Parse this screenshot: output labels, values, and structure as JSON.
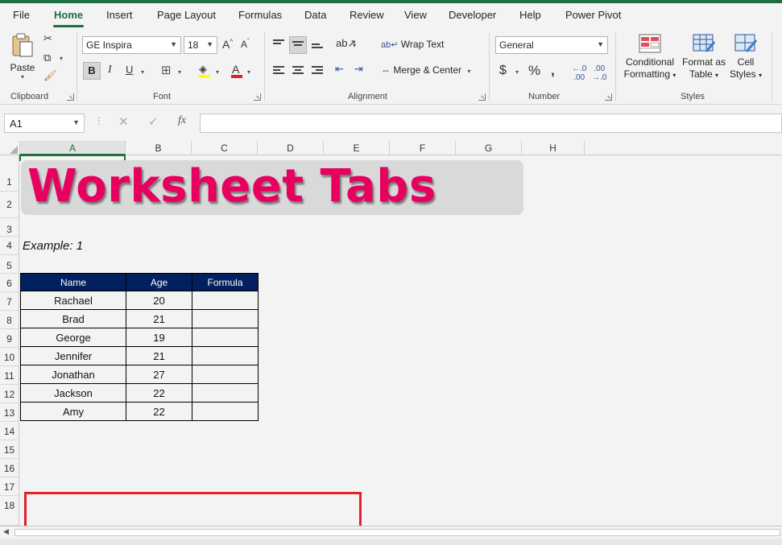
{
  "menu": {
    "items": [
      "File",
      "Home",
      "Insert",
      "Page Layout",
      "Formulas",
      "Data",
      "Review",
      "View",
      "Developer",
      "Help",
      "Power Pivot"
    ]
  },
  "ribbon": {
    "clipboard": {
      "paste_label": "Paste",
      "group_label": "Clipboard"
    },
    "font": {
      "font_name": "GE Inspira",
      "font_size": "18",
      "group_label": "Font"
    },
    "alignment": {
      "wrap_text": "Wrap Text",
      "merge_center": "Merge & Center",
      "group_label": "Alignment"
    },
    "number": {
      "format": "General",
      "group_label": "Number"
    },
    "styles": {
      "conditional_line1": "Conditional",
      "conditional_line2": "Formatting",
      "format_table_line1": "Format as",
      "format_table_line2": "Table",
      "cell_styles_line1": "Cell",
      "cell_styles_line2": "Styles",
      "group_label": "Styles"
    }
  },
  "formula_bar": {
    "name_box": "A1",
    "formula": ""
  },
  "columns": [
    "A",
    "B",
    "C",
    "D",
    "E",
    "F",
    "G",
    "H"
  ],
  "rows": [
    "1",
    "2",
    "3",
    "4",
    "5",
    "6",
    "7",
    "8",
    "9",
    "10",
    "11",
    "12",
    "13",
    "14",
    "15",
    "16",
    "17",
    "18"
  ],
  "sheet": {
    "title": "Worksheet Tabs",
    "example_label": "Example: 1",
    "table": {
      "headers": [
        "Name",
        "Age",
        "Formula"
      ],
      "rows": [
        [
          "Rachael",
          "20",
          ""
        ],
        [
          "Brad",
          "21",
          ""
        ],
        [
          "George",
          "19",
          ""
        ],
        [
          "Jennifer",
          "21",
          ""
        ],
        [
          "Jonathan",
          "27",
          ""
        ],
        [
          "Jackson",
          "22",
          ""
        ],
        [
          "Amy",
          "22",
          ""
        ]
      ]
    }
  },
  "colors": {
    "accent": "#1e6e42",
    "title": "#e8005f",
    "header_fill": "#002060",
    "highlight": "#e32128"
  }
}
